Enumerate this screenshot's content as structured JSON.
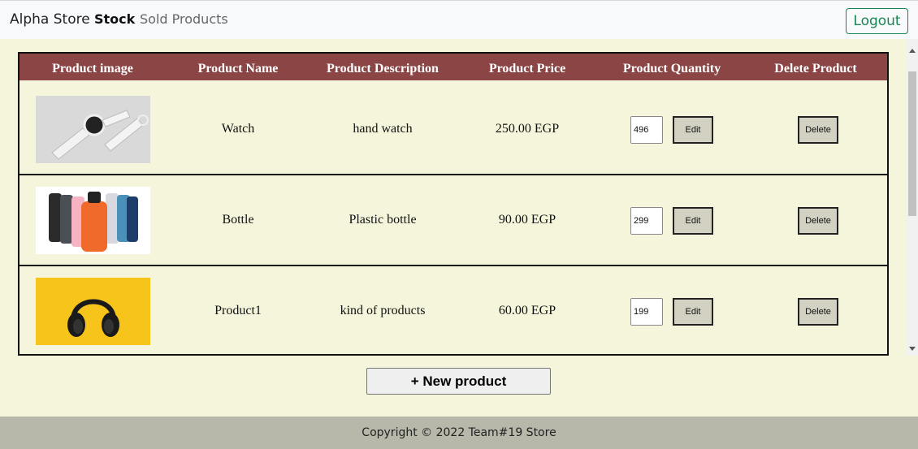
{
  "nav": {
    "brand": "Alpha Store",
    "stock": "Stock",
    "sold": "Sold Products",
    "logout": "Logout"
  },
  "table": {
    "headers": [
      "Product image",
      "Product Name",
      "Product Description",
      "Product Price",
      "Product Quantity",
      "Delete Product"
    ],
    "rows": [
      {
        "image": "watch-image",
        "name": "Watch",
        "description": "hand watch",
        "price": "250.00 EGP",
        "quantity": "496",
        "edit": "Edit",
        "delete": "Delete"
      },
      {
        "image": "bottles-image",
        "name": "Bottle",
        "description": "Plastic bottle",
        "price": "90.00 EGP",
        "quantity": "299",
        "edit": "Edit",
        "delete": "Delete"
      },
      {
        "image": "headphones-image",
        "name": "Product1",
        "description": "kind of products",
        "price": "60.00 EGP",
        "quantity": "199",
        "edit": "Edit",
        "delete": "Delete"
      }
    ]
  },
  "new_product": "+ New product",
  "footer": "Copyright © 2022 Team#19 Store",
  "colors": {
    "header_bg": "#8b4545",
    "page_bg": "#f5f5dc",
    "logout": "#198754",
    "footer_bg": "#b7b8aa"
  }
}
